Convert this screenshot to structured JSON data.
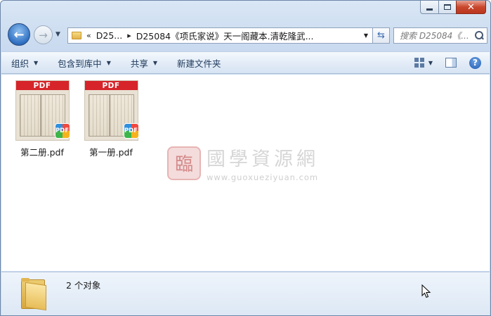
{
  "window": {
    "minimize_glyph": "",
    "close_glyph": "✕"
  },
  "nav": {
    "back_icon": "arrow-left-icon",
    "forward_icon": "arrow-right-icon",
    "breadcrumb_root": "D25...",
    "breadcrumb_current": "D25084《项氏家说》天一阁藏本.清乾隆武...",
    "search_placeholder": "搜索 D25084《...",
    "refresh_icon": "refresh-icon"
  },
  "toolbar": {
    "organize": "组织",
    "include_in_library": "包含到库中",
    "share": "共享",
    "new_folder": "新建文件夹",
    "help_glyph": "?"
  },
  "files": [
    {
      "name": "第二册.pdf",
      "band": "PDF",
      "badge": "PDF"
    },
    {
      "name": "第一册.pdf",
      "band": "PDF",
      "badge": "PDF"
    }
  ],
  "watermark": {
    "seal": "臨",
    "title": "國學資源網",
    "url": "www.guoxueziyuan.com"
  },
  "status": {
    "count_text": "2 个对象"
  },
  "colors": {
    "pdf_band": "#d6242a",
    "toolbar_text": "#1e395b"
  }
}
